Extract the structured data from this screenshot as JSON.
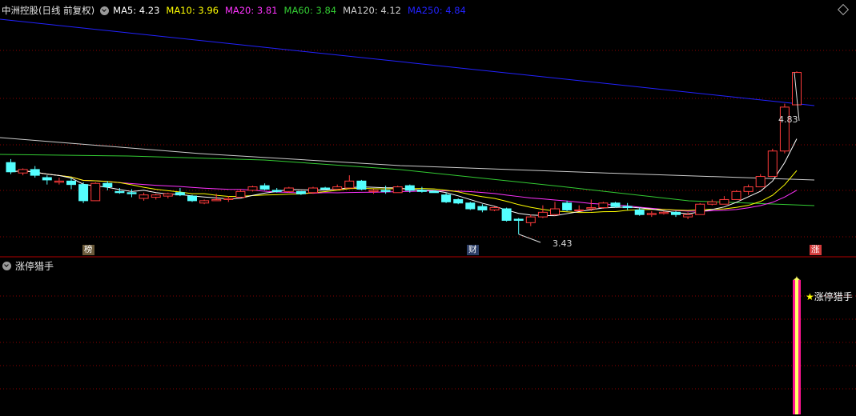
{
  "header": {
    "title": "中洲控股(日线 前复权)",
    "ma_items": [
      {
        "label": "MA5: 4.23",
        "color": "#ffffff"
      },
      {
        "label": "MA10: 3.96",
        "color": "#ffff00"
      },
      {
        "label": "MA20: 3.81",
        "color": "#ff33ff"
      },
      {
        "label": "MA60: 3.84",
        "color": "#33cc33"
      },
      {
        "label": "MA120: 4.12",
        "color": "#cccccc"
      },
      {
        "label": "MA250: 4.84",
        "color": "#2222ff"
      }
    ]
  },
  "price_annotations": {
    "high": "4.83",
    "low": "3.43"
  },
  "event_flags": [
    {
      "text": "榜",
      "bg": "#6b5a3a",
      "color": "#ffffff"
    },
    {
      "text": "财",
      "bg": "#2c3e66",
      "color": "#ffffff"
    },
    {
      "text": "涨",
      "bg": "#d43b3b",
      "color": "#ffffff"
    }
  ],
  "indicator_panel": {
    "title": "涨停猎手",
    "signal_label": "涨停猎手",
    "star": "★"
  },
  "colors": {
    "up": "#ff3b3b",
    "down": "#54ffff",
    "grid": "#8b0000",
    "ma250": "#2222ff",
    "ma120": "#cccccc",
    "ma60": "#33cc33",
    "ma20": "#ff33ff",
    "ma10": "#ffff00",
    "ma5": "#ffffff"
  },
  "candles": [
    [
      4.05,
      3.97,
      4.08,
      3.95
    ],
    [
      3.96,
      3.99,
      4.0,
      3.94
    ],
    [
      3.99,
      3.94,
      4.02,
      3.92
    ],
    [
      3.92,
      3.9,
      3.94,
      3.86
    ],
    [
      3.88,
      3.89,
      3.92,
      3.86
    ],
    [
      3.89,
      3.86,
      3.92,
      3.82
    ],
    [
      3.86,
      3.72,
      3.88,
      3.7
    ],
    [
      3.72,
      3.87,
      3.88,
      3.72
    ],
    [
      3.87,
      3.84,
      3.89,
      3.81
    ],
    [
      3.8,
      3.79,
      3.83,
      3.78
    ],
    [
      3.79,
      3.78,
      3.82,
      3.75
    ],
    [
      3.74,
      3.77,
      3.79,
      3.72
    ],
    [
      3.75,
      3.77,
      3.78,
      3.73
    ],
    [
      3.76,
      3.78,
      3.79,
      3.74
    ],
    [
      3.79,
      3.77,
      3.83,
      3.76
    ],
    [
      3.76,
      3.72,
      3.77,
      3.71
    ],
    [
      3.7,
      3.72,
      3.73,
      3.69
    ],
    [
      3.72,
      3.73,
      3.78,
      3.72
    ],
    [
      3.73,
      3.74,
      3.76,
      3.71
    ],
    [
      3.75,
      3.8,
      3.82,
      3.75
    ],
    [
      3.81,
      3.84,
      3.85,
      3.8
    ],
    [
      3.85,
      3.82,
      3.87,
      3.81
    ],
    [
      3.81,
      3.8,
      3.83,
      3.79
    ],
    [
      3.8,
      3.83,
      3.84,
      3.79
    ],
    [
      3.8,
      3.78,
      3.8,
      3.77
    ],
    [
      3.79,
      3.83,
      3.84,
      3.78
    ],
    [
      3.83,
      3.82,
      3.84,
      3.82
    ],
    [
      3.82,
      3.84,
      3.86,
      3.82
    ],
    [
      3.83,
      3.89,
      3.94,
      3.83
    ],
    [
      3.89,
      3.82,
      3.9,
      3.81
    ],
    [
      3.8,
      3.81,
      3.82,
      3.78
    ],
    [
      3.81,
      3.8,
      3.85,
      3.78
    ],
    [
      3.79,
      3.84,
      3.85,
      3.79
    ],
    [
      3.85,
      3.81,
      3.86,
      3.79
    ],
    [
      3.81,
      3.8,
      3.84,
      3.79
    ],
    [
      3.8,
      3.79,
      3.81,
      3.79
    ],
    [
      3.77,
      3.71,
      3.79,
      3.7
    ],
    [
      3.73,
      3.7,
      3.74,
      3.69
    ],
    [
      3.7,
      3.65,
      3.71,
      3.64
    ],
    [
      3.67,
      3.64,
      3.69,
      3.62
    ],
    [
      3.64,
      3.66,
      3.67,
      3.63
    ],
    [
      3.65,
      3.55,
      3.66,
      3.54
    ],
    [
      3.56,
      3.55,
      3.57,
      3.43
    ],
    [
      3.53,
      3.58,
      3.6,
      3.5
    ],
    [
      3.58,
      3.62,
      3.68,
      3.57
    ],
    [
      3.6,
      3.65,
      3.71,
      3.59
    ],
    [
      3.7,
      3.64,
      3.72,
      3.63
    ],
    [
      3.64,
      3.64,
      3.68,
      3.64
    ],
    [
      3.65,
      3.66,
      3.73,
      3.63
    ],
    [
      3.66,
      3.7,
      3.71,
      3.65
    ],
    [
      3.7,
      3.67,
      3.71,
      3.66
    ],
    [
      3.67,
      3.66,
      3.7,
      3.64
    ],
    [
      3.64,
      3.6,
      3.66,
      3.59
    ],
    [
      3.6,
      3.61,
      3.63,
      3.58
    ],
    [
      3.61,
      3.62,
      3.63,
      3.6
    ],
    [
      3.62,
      3.6,
      3.63,
      3.58
    ],
    [
      3.58,
      3.6,
      3.62,
      3.56
    ],
    [
      3.6,
      3.69,
      3.7,
      3.6
    ],
    [
      3.69,
      3.71,
      3.73,
      3.68
    ],
    [
      3.69,
      3.73,
      3.76,
      3.69
    ],
    [
      3.73,
      3.8,
      3.81,
      3.73
    ],
    [
      3.8,
      3.84,
      3.86,
      3.77
    ],
    [
      3.84,
      3.93,
      3.95,
      3.84
    ],
    [
      3.93,
      4.15,
      4.17,
      3.93
    ],
    [
      4.15,
      4.53,
      4.56,
      4.13
    ],
    [
      4.55,
      4.83,
      4.84,
      4.55
    ]
  ]
}
